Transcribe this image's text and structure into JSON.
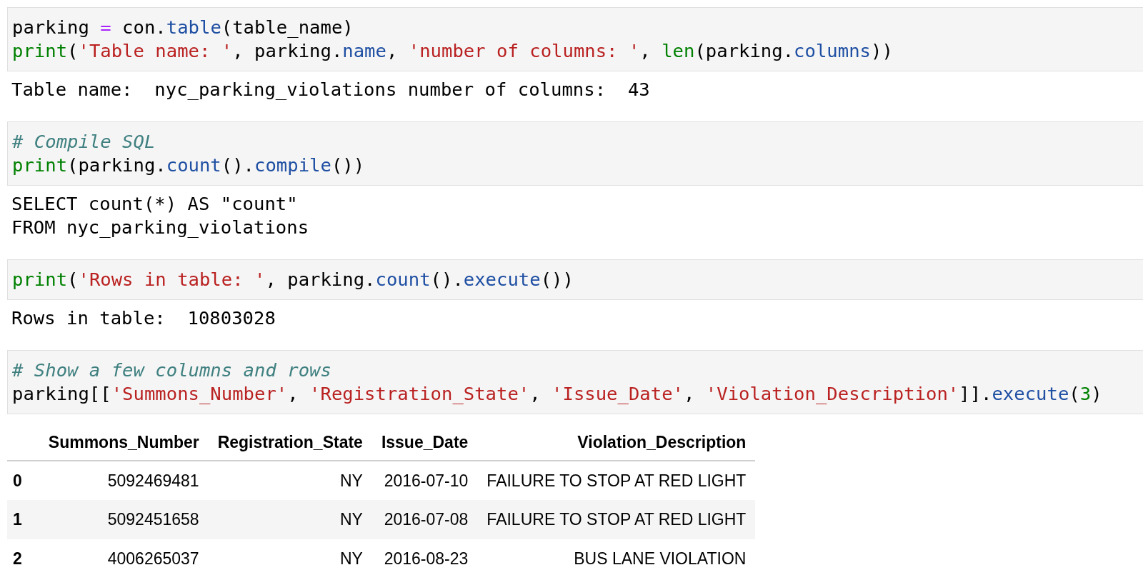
{
  "cells": [
    {
      "code": [
        [
          {
            "kind": "plain",
            "text": "parking "
          },
          {
            "kind": "op",
            "text": "="
          },
          {
            "kind": "plain",
            "text": " con."
          },
          {
            "kind": "attr",
            "text": "table"
          },
          {
            "kind": "plain",
            "text": "(table_name)"
          }
        ],
        [
          {
            "kind": "builtin",
            "text": "print"
          },
          {
            "kind": "plain",
            "text": "("
          },
          {
            "kind": "string",
            "text": "'Table name: '"
          },
          {
            "kind": "plain",
            "text": ", parking."
          },
          {
            "kind": "attr",
            "text": "name"
          },
          {
            "kind": "plain",
            "text": ", "
          },
          {
            "kind": "string",
            "text": "'number of columns: '"
          },
          {
            "kind": "plain",
            "text": ", "
          },
          {
            "kind": "builtin",
            "text": "len"
          },
          {
            "kind": "plain",
            "text": "(parking."
          },
          {
            "kind": "attr",
            "text": "columns"
          },
          {
            "kind": "plain",
            "text": "))"
          }
        ]
      ],
      "output": {
        "kind": "text",
        "lines": [
          "Table name:  nyc_parking_violations number of columns:  43"
        ]
      }
    },
    {
      "code": [
        [
          {
            "kind": "comment",
            "text": "# Compile SQL"
          }
        ],
        [
          {
            "kind": "builtin",
            "text": "print"
          },
          {
            "kind": "plain",
            "text": "(parking."
          },
          {
            "kind": "attr",
            "text": "count"
          },
          {
            "kind": "plain",
            "text": "()."
          },
          {
            "kind": "attr",
            "text": "compile"
          },
          {
            "kind": "plain",
            "text": "())"
          }
        ]
      ],
      "output": {
        "kind": "text",
        "lines": [
          "SELECT count(*) AS \"count\"",
          "FROM nyc_parking_violations"
        ]
      }
    },
    {
      "code": [
        [
          {
            "kind": "builtin",
            "text": "print"
          },
          {
            "kind": "plain",
            "text": "("
          },
          {
            "kind": "string",
            "text": "'Rows in table: '"
          },
          {
            "kind": "plain",
            "text": ", parking."
          },
          {
            "kind": "attr",
            "text": "count"
          },
          {
            "kind": "plain",
            "text": "()."
          },
          {
            "kind": "attr",
            "text": "execute"
          },
          {
            "kind": "plain",
            "text": "())"
          }
        ]
      ],
      "output": {
        "kind": "text",
        "lines": [
          "Rows in table:  10803028"
        ]
      }
    },
    {
      "code": [
        [
          {
            "kind": "comment",
            "text": "# Show a few columns and rows"
          }
        ],
        [
          {
            "kind": "plain",
            "text": "parking[["
          },
          {
            "kind": "string",
            "text": "'Summons_Number'"
          },
          {
            "kind": "plain",
            "text": ", "
          },
          {
            "kind": "string",
            "text": "'Registration_State'"
          },
          {
            "kind": "plain",
            "text": ", "
          },
          {
            "kind": "string",
            "text": "'Issue_Date'"
          },
          {
            "kind": "plain",
            "text": ", "
          },
          {
            "kind": "string",
            "text": "'Violation_Description'"
          },
          {
            "kind": "plain",
            "text": "]]."
          },
          {
            "kind": "attr",
            "text": "execute"
          },
          {
            "kind": "plain",
            "text": "("
          },
          {
            "kind": "number",
            "text": "3"
          },
          {
            "kind": "plain",
            "text": ")"
          }
        ]
      ],
      "output": {
        "kind": "table",
        "columns": [
          "Summons_Number",
          "Registration_State",
          "Issue_Date",
          "Violation_Description"
        ],
        "rows": [
          {
            "index": "0",
            "cells": [
              "5092469481",
              "NY",
              "2016-07-10",
              "FAILURE TO STOP AT RED LIGHT"
            ]
          },
          {
            "index": "1",
            "cells": [
              "5092451658",
              "NY",
              "2016-07-08",
              "FAILURE TO STOP AT RED LIGHT"
            ]
          },
          {
            "index": "2",
            "cells": [
              "4006265037",
              "NY",
              "2016-08-23",
              "BUS LANE VIOLATION"
            ]
          }
        ]
      }
    }
  ]
}
